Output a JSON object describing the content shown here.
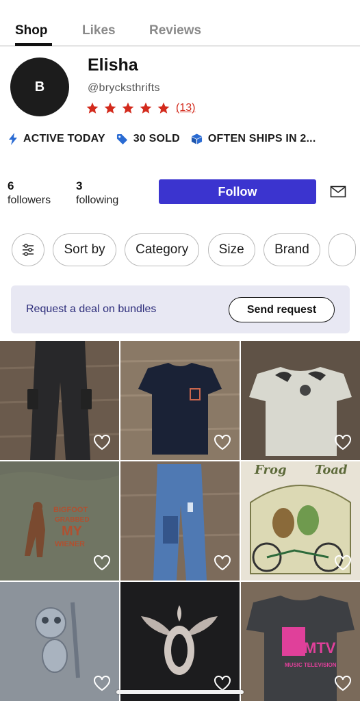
{
  "tabs": [
    {
      "label": "Shop",
      "active": true
    },
    {
      "label": "Likes",
      "active": false
    },
    {
      "label": "Reviews",
      "active": false
    }
  ],
  "profile": {
    "avatar_initial": "B",
    "name": "Elisha",
    "handle": "@brycksthrifts",
    "rating_stars": 5,
    "rating_count": "(13)"
  },
  "badges": [
    {
      "icon": "lightning-icon",
      "label": "ACTIVE TODAY"
    },
    {
      "icon": "tag-icon",
      "label": "30 SOLD"
    },
    {
      "icon": "box-icon",
      "label": "OFTEN SHIPS IN 2..."
    }
  ],
  "stats": {
    "followers_count": "6",
    "followers_label": "followers",
    "following_count": "3",
    "following_label": "following"
  },
  "follow_label": "Follow",
  "filters": {
    "icon": "sliders-icon",
    "chips": [
      "Sort by",
      "Category",
      "Size",
      "Brand"
    ]
  },
  "banner": {
    "text": "Request a deal on bundles",
    "button_label": "Send request"
  },
  "listings": [
    {
      "subject": "black cargo pants"
    },
    {
      "subject": "navy t-shirt"
    },
    {
      "subject": "white graphic t-shirt"
    },
    {
      "subject": "Bigfoot graphic tee",
      "print": [
        "BIGFOOT",
        "GRABBED",
        "MY",
        "WIENER"
      ]
    },
    {
      "subject": "blue jeans"
    },
    {
      "subject": "Frog and Toad tee",
      "print": [
        "Frog",
        "Toad"
      ]
    },
    {
      "subject": "Tweety graphic tee"
    },
    {
      "subject": "black eagle graphic tee"
    },
    {
      "subject": "gray MTV tee",
      "print": [
        "MTV",
        "MUSIC TELEVISION"
      ]
    }
  ],
  "colors": {
    "accent": "#3b34cf",
    "star": "#d32a1c",
    "badge_icon": "#2a6bd3"
  }
}
